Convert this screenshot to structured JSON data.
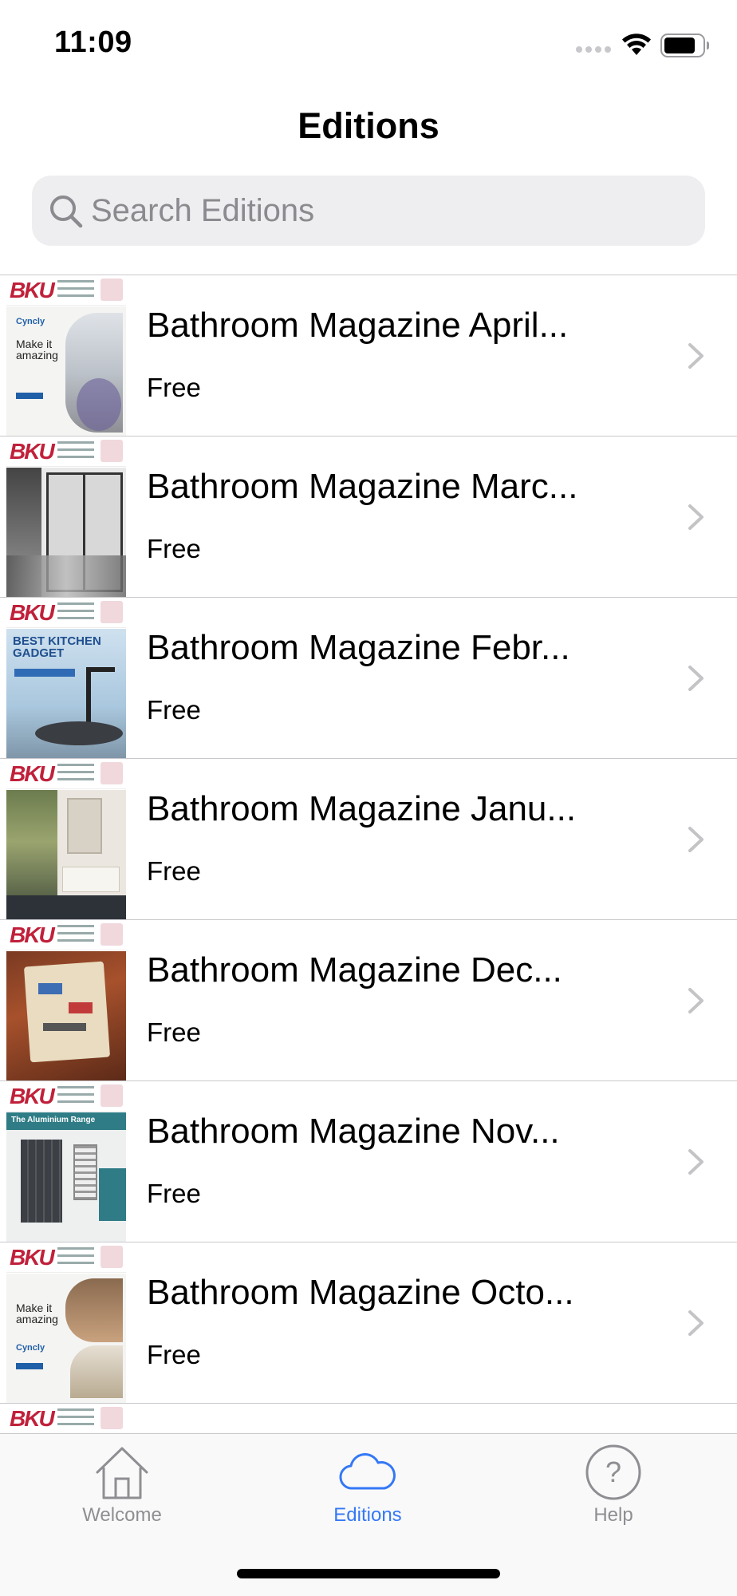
{
  "status_bar": {
    "time": "11:09"
  },
  "nav": {
    "title": "Editions"
  },
  "search": {
    "placeholder": "Search Editions",
    "value": ""
  },
  "editions": [
    {
      "title": "Bathroom Magazine April...",
      "price": "Free",
      "thumb_logo": "BKU",
      "thumb_text": "Make it amazing",
      "thumb_brand": "Cyncly"
    },
    {
      "title": "Bathroom Magazine Marc...",
      "price": "Free",
      "thumb_logo": "BKU"
    },
    {
      "title": "Bathroom Magazine Febr...",
      "price": "Free",
      "thumb_logo": "BKU",
      "thumb_text": "BEST KITCHEN GADGET"
    },
    {
      "title": "Bathroom Magazine Janu...",
      "price": "Free",
      "thumb_logo": "BKU"
    },
    {
      "title": "Bathroom Magazine Dec...",
      "price": "Free",
      "thumb_logo": "BKU"
    },
    {
      "title": "Bathroom Magazine Nov...",
      "price": "Free",
      "thumb_logo": "BKU",
      "thumb_text": "The Aluminium Range"
    },
    {
      "title": "Bathroom Magazine Octo...",
      "price": "Free",
      "thumb_logo": "BKU",
      "thumb_text": "Make it amazing",
      "thumb_brand": "Cyncly"
    },
    {
      "title": "",
      "price": "",
      "thumb_logo": "BKU"
    }
  ],
  "tabs": [
    {
      "label": "Welcome",
      "icon": "home-icon",
      "selected": false
    },
    {
      "label": "Editions",
      "icon": "cloud-icon",
      "selected": true
    },
    {
      "label": "Help",
      "icon": "question-icon",
      "selected": false
    }
  ],
  "colors": {
    "accent": "#3478f6",
    "inactive_tab": "#8e8e93",
    "separator": "#c9c9cd",
    "search_bg": "#eeeef0",
    "logo_red": "#c0203a"
  }
}
